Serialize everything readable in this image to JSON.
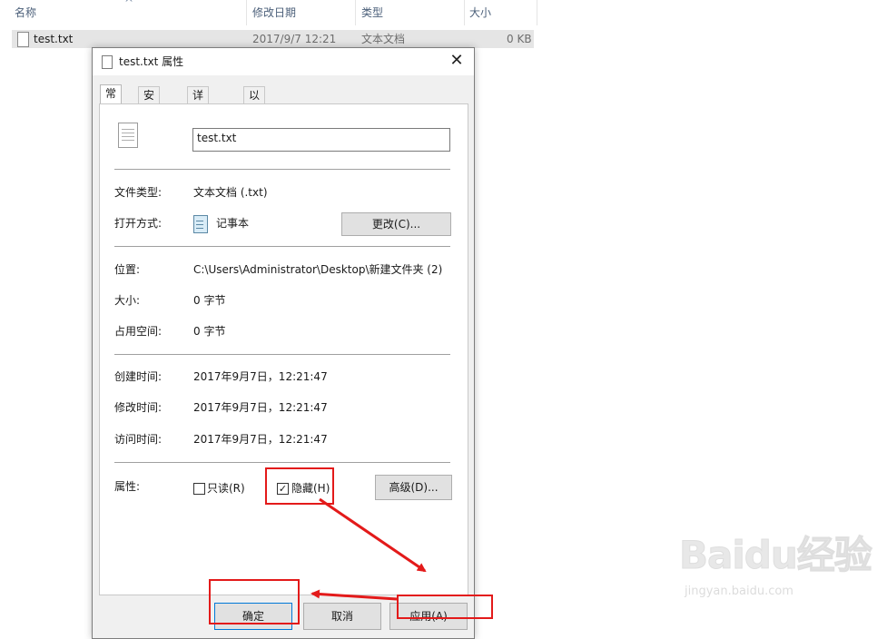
{
  "explorer": {
    "columns": [
      "名称",
      "修改日期",
      "类型",
      "大小"
    ],
    "file": {
      "name": "test.txt",
      "modified": "2017/9/7 12:21",
      "type": "文本文档",
      "size": "0 KB"
    }
  },
  "dialog": {
    "title": "test.txt 属性",
    "close": "✕",
    "tabs": [
      "常规",
      "安全",
      "详细信息",
      "以前的版本"
    ],
    "filename": "test.txt",
    "file_type_label": "文件类型:",
    "file_type_value": "文本文档 (.txt)",
    "open_with_label": "打开方式:",
    "open_with_value": "记事本",
    "change_button": "更改(C)...",
    "location_label": "位置:",
    "location_value": "C:\\Users\\Administrator\\Desktop\\新建文件夹 (2)",
    "size_label": "大小:",
    "size_value": "0 字节",
    "disk_size_label": "占用空间:",
    "disk_size_value": "0 字节",
    "created_label": "创建时间:",
    "created_value": "2017年9月7日，12:21:47",
    "modified_label": "修改时间:",
    "modified_value": "2017年9月7日，12:21:47",
    "accessed_label": "访问时间:",
    "accessed_value": "2017年9月7日，12:21:47",
    "attributes_label": "属性:",
    "readonly_label": "只读(R)",
    "readonly_checked": false,
    "hidden_label": "隐藏(H)",
    "hidden_checked": true,
    "hidden_check_mark": "✓",
    "advanced_button": "高级(D)...",
    "ok_button": "确定",
    "cancel_button": "取消",
    "apply_button": "应用(A)"
  },
  "annotation": {
    "color": "#e31a1a"
  },
  "watermark": {
    "text": "Baidu经验",
    "url": "jingyan.baidu.com"
  }
}
